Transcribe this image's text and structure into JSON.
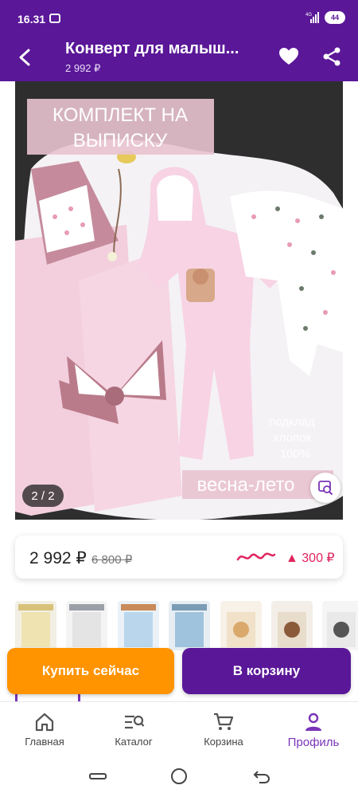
{
  "status_bar": {
    "time": "16.31",
    "battery": "44",
    "network": "4G"
  },
  "header": {
    "title": "Конверт для малыш...",
    "price_subtitle": "2 992 ₽"
  },
  "gallery": {
    "counter": "2 / 2",
    "overlay_texts": {
      "heading_line1": "КОМПЛЕКТ НА",
      "heading_line2": "ВЫПИСКУ",
      "lining_line1": "подклад",
      "lining_line2": "хлопок",
      "lining_line3": "100%",
      "season": "весна-лето"
    }
  },
  "price": {
    "current": "2 992 ₽",
    "old": "6 800 ₽",
    "change": "▲ 300 ₽",
    "change_color": "#e0245e"
  },
  "thumbnails": [
    "thumb-1",
    "thumb-2",
    "thumb-3",
    "thumb-4",
    "thumb-5",
    "thumb-6",
    "thumb-7"
  ],
  "actions": {
    "buy_now": "Купить сейчас",
    "add_to_cart": "В корзину"
  },
  "bottom_nav": {
    "items": [
      {
        "label": "Главная",
        "icon": "home-icon"
      },
      {
        "label": "Каталог",
        "icon": "catalog-search-icon"
      },
      {
        "label": "Корзина",
        "icon": "cart-icon"
      },
      {
        "label": "Профиль",
        "icon": "profile-icon",
        "active": true
      }
    ]
  },
  "colors": {
    "brand": "#5a1798",
    "accent_orange": "#ff9300",
    "active_nav": "#7a34b8"
  }
}
